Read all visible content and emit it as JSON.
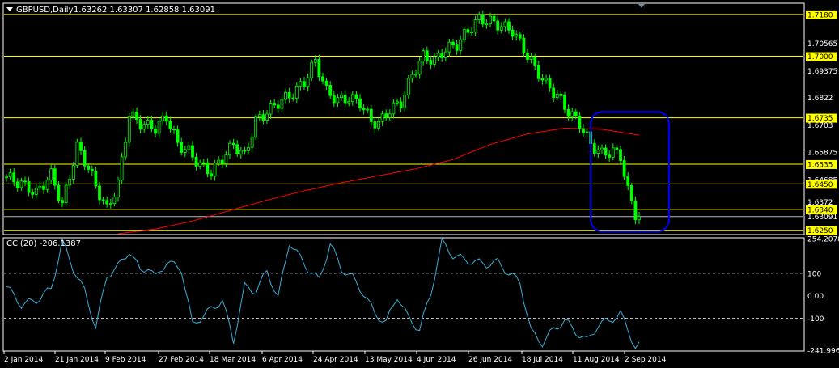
{
  "header": {
    "symbol_label": "GBPUSD,Daily",
    "ohlc": "1.63262 1.63307 1.62858 1.63091",
    "indicator_label": "CCI(20) -206.1387"
  },
  "colors": {
    "background": "#000000",
    "bull_candle": "#00ff00",
    "bear_candle": "#00ff00",
    "ma_line": "#ff0000",
    "hline": "#ffff00",
    "cci_line": "#3aaed8",
    "annotation_box": "#0000ff",
    "axis": "#ffffff",
    "price_label_bg": "#ffff00"
  },
  "chart_data": [
    {
      "type": "candlestick",
      "series_description": "GBPUSD daily OHLC",
      "x_labels": [
        "2 Jan 2014",
        "21 Jan 2014",
        "9 Feb 2014",
        "27 Feb 2014",
        "18 Mar 2014",
        "6 Apr 2014",
        "24 Apr 2014",
        "13 May 2014",
        "4 Jun 2014",
        "26 Jun 2014",
        "18 Jul 2014",
        "11 Aug 2014",
        "2 Sep 2014"
      ],
      "y_axis_ticks": [
        1.718,
        1.70565,
        1.7,
        1.69375,
        1.6822,
        1.6735,
        1.6703,
        1.65875,
        1.6535,
        1.64685,
        1.645,
        1.6372,
        1.634,
        1.63091,
        1.625
      ],
      "highlighted_ticks": [
        1.718,
        1.7,
        1.6735,
        1.6535,
        1.645,
        1.634,
        1.625
      ],
      "ylim": [
        1.6235,
        1.7225
      ],
      "horizontal_lines": [
        1.718,
        1.7,
        1.6735,
        1.6535,
        1.645,
        1.634,
        1.625
      ],
      "current_price_line": 1.63091,
      "close_anchors": [
        [
          0,
          1.648
        ],
        [
          4,
          1.645
        ],
        [
          8,
          1.641
        ],
        [
          12,
          1.649
        ],
        [
          15,
          1.636
        ],
        [
          19,
          1.661
        ],
        [
          22,
          1.652
        ],
        [
          24,
          1.644
        ],
        [
          27,
          1.634
        ],
        [
          30,
          1.645
        ],
        [
          33,
          1.675
        ],
        [
          36,
          1.671
        ],
        [
          40,
          1.669
        ],
        [
          43,
          1.674
        ],
        [
          46,
          1.662
        ],
        [
          49,
          1.659
        ],
        [
          52,
          1.653
        ],
        [
          55,
          1.65
        ],
        [
          58,
          1.656
        ],
        [
          61,
          1.662
        ],
        [
          64,
          1.657
        ],
        [
          67,
          1.672
        ],
        [
          70,
          1.676
        ],
        [
          73,
          1.68
        ],
        [
          77,
          1.684
        ],
        [
          80,
          1.689
        ],
        [
          83,
          1.698
        ],
        [
          86,
          1.685
        ],
        [
          89,
          1.681
        ],
        [
          92,
          1.682
        ],
        [
          95,
          1.68
        ],
        [
          98,
          1.672
        ],
        [
          100,
          1.671
        ],
        [
          103,
          1.677
        ],
        [
          106,
          1.68
        ],
        [
          109,
          1.692
        ],
        [
          112,
          1.7
        ],
        [
          115,
          1.698
        ],
        [
          118,
          1.703
        ],
        [
          121,
          1.705
        ],
        [
          124,
          1.711
        ],
        [
          127,
          1.716
        ],
        [
          130,
          1.715
        ],
        [
          133,
          1.713
        ],
        [
          136,
          1.711
        ],
        [
          139,
          1.703
        ],
        [
          142,
          1.695
        ],
        [
          145,
          1.688
        ],
        [
          148,
          1.683
        ],
        [
          151,
          1.676
        ],
        [
          154,
          1.671
        ],
        [
          157,
          1.662
        ],
        [
          160,
          1.658
        ],
        [
          163,
          1.659
        ],
        [
          165,
          1.657
        ],
        [
          167,
          1.642
        ],
        [
          169,
          1.632
        ],
        [
          170,
          1.6309
        ]
      ],
      "ma_anchors": [
        [
          30,
          1.6235
        ],
        [
          40,
          1.6255
        ],
        [
          50,
          1.629
        ],
        [
          60,
          1.6335
        ],
        [
          70,
          1.638
        ],
        [
          80,
          1.642
        ],
        [
          90,
          1.6455
        ],
        [
          100,
          1.6485
        ],
        [
          110,
          1.6515
        ],
        [
          120,
          1.6555
        ],
        [
          130,
          1.662
        ],
        [
          140,
          1.6665
        ],
        [
          150,
          1.669
        ],
        [
          160,
          1.6685
        ],
        [
          170,
          1.666
        ]
      ],
      "ma_clip_start": 30,
      "annotation": "rounded rectangle around the recent decline",
      "annotation_range": [
        157,
        178,
        1.676,
        1.6245
      ]
    },
    {
      "type": "line",
      "series_description": "CCI(20) oscillator",
      "y_axis_ticks": [
        254.2078,
        100,
        0.0,
        -100,
        -241.996
      ],
      "ylim": [
        -241.996,
        254.2078
      ],
      "reference_levels": [
        100,
        -100
      ],
      "value_anchors": [
        [
          0,
          40
        ],
        [
          4,
          -40
        ],
        [
          8,
          -20
        ],
        [
          12,
          30
        ],
        [
          15,
          240
        ],
        [
          18,
          120
        ],
        [
          21,
          20
        ],
        [
          24,
          -140
        ],
        [
          27,
          90
        ],
        [
          30,
          130
        ],
        [
          33,
          200
        ],
        [
          36,
          110
        ],
        [
          38,
          130
        ],
        [
          40,
          80
        ],
        [
          43,
          150
        ],
        [
          47,
          120
        ],
        [
          50,
          -130
        ],
        [
          52,
          -100
        ],
        [
          55,
          -60
        ],
        [
          58,
          -20
        ],
        [
          61,
          -200
        ],
        [
          64,
          40
        ],
        [
          67,
          20
        ],
        [
          70,
          110
        ],
        [
          73,
          -10
        ],
        [
          76,
          240
        ],
        [
          78,
          190
        ],
        [
          81,
          120
        ],
        [
          84,
          70
        ],
        [
          87,
          230
        ],
        [
          90,
          120
        ],
        [
          93,
          80
        ],
        [
          96,
          10
        ],
        [
          99,
          -80
        ],
        [
          102,
          -120
        ],
        [
          105,
          0
        ],
        [
          108,
          -100
        ],
        [
          111,
          -150
        ],
        [
          114,
          10
        ],
        [
          117,
          240
        ],
        [
          120,
          180
        ],
        [
          123,
          160
        ],
        [
          126,
          150
        ],
        [
          129,
          140
        ],
        [
          132,
          150
        ],
        [
          135,
          100
        ],
        [
          138,
          60
        ],
        [
          141,
          -160
        ],
        [
          144,
          -210
        ],
        [
          147,
          -150
        ],
        [
          150,
          -110
        ],
        [
          153,
          -160
        ],
        [
          156,
          -200
        ],
        [
          159,
          -130
        ],
        [
          162,
          -110
        ],
        [
          165,
          -80
        ],
        [
          167,
          -150
        ],
        [
          169,
          -230
        ],
        [
          170,
          -206.14
        ]
      ]
    }
  ]
}
